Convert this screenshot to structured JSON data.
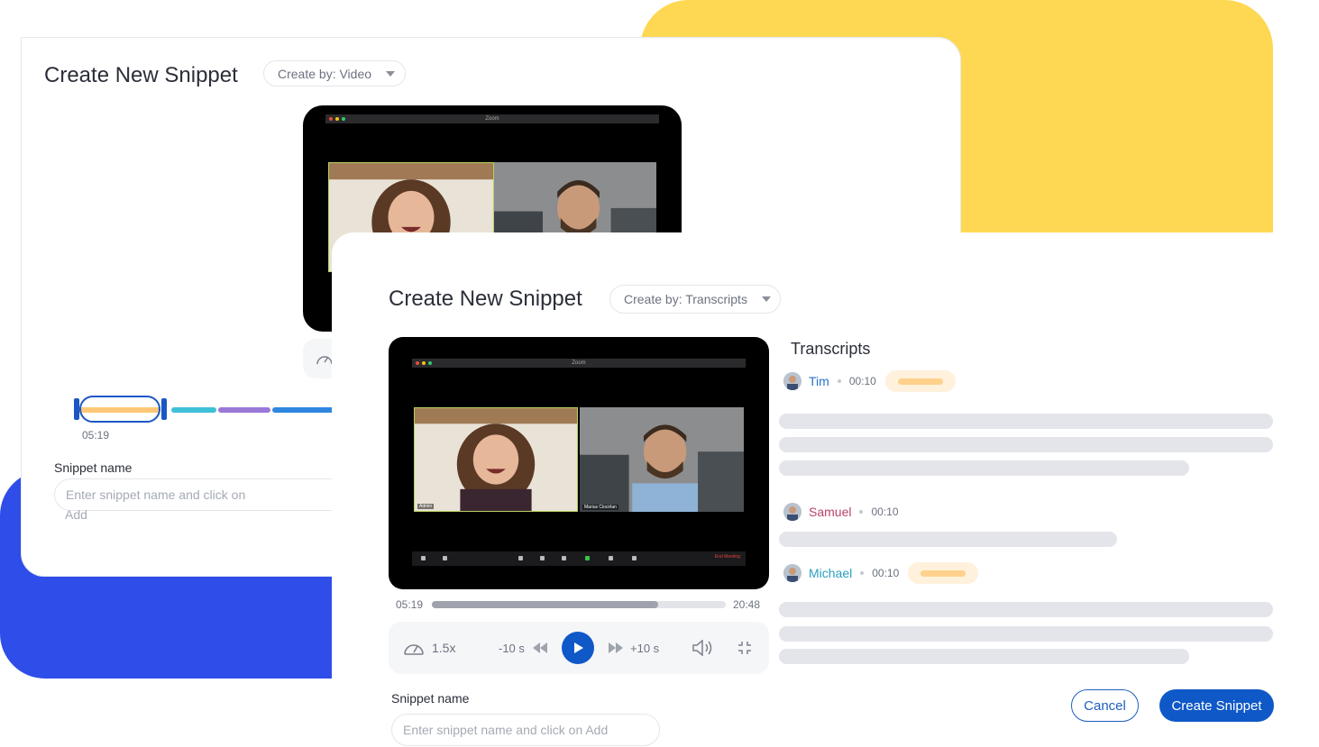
{
  "colors": {
    "accent": "#0f58c7",
    "yellow": "#fed853",
    "blue_blob": "#2f4de8"
  },
  "back_card": {
    "title": "Create New Snippet",
    "create_by": "Create by: Video",
    "zoom_title": "Zoom",
    "timeline_time": "05:19",
    "snippet_label": "Snippet name",
    "snippet_placeholder_line1": "Enter snippet name and click on",
    "snippet_placeholder_line2": "Add"
  },
  "front_card": {
    "title": "Create New Snippet",
    "create_by": "Create by: Transcripts",
    "zoom_title": "Zoom",
    "tile_names": [
      "Admin",
      "Marius Ciocirlan"
    ],
    "end_meeting": "End Meeting",
    "player": {
      "current_time": "05:19",
      "duration": "20:48",
      "progress": 0.77,
      "speed": "1.5x",
      "rewind": "-10 s",
      "forward": "+10 s"
    },
    "transcripts": {
      "title": "Transcripts",
      "entries": [
        {
          "name": "Tim",
          "time": "00:10",
          "color": "#2a74c9"
        },
        {
          "name": "Samuel",
          "time": "00:10",
          "color": "#b8436b"
        },
        {
          "name": "Michael",
          "time": "00:10",
          "color": "#2aa0c0"
        }
      ]
    },
    "snippet_label": "Snippet name",
    "snippet_placeholder": "Enter snippet name and click on Add",
    "cancel": "Cancel",
    "create": "Create Snippet"
  }
}
